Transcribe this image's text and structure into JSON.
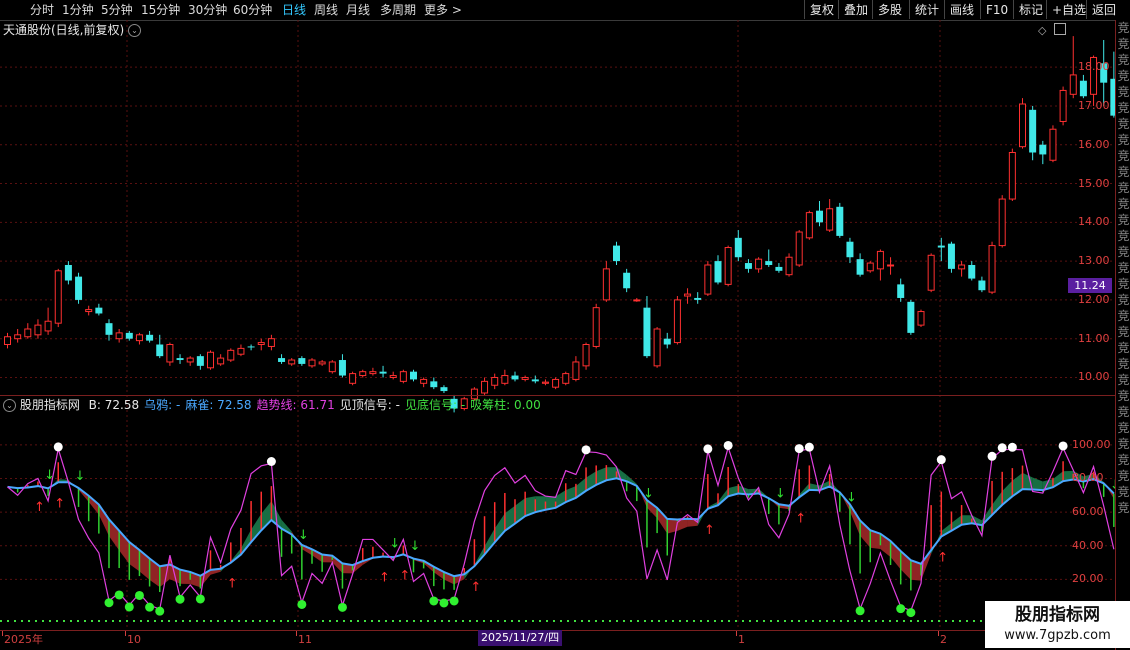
{
  "toolbar": {
    "periods": [
      "分时",
      "1分钟",
      "5分钟",
      "15分钟",
      "30分钟",
      "60分钟",
      "日线",
      "周线",
      "月线",
      "多周期",
      "更多 >"
    ],
    "active_period": "日线",
    "right_buttons": [
      "复权",
      "叠加",
      "多股",
      "统计",
      "画线",
      "F10",
      "标记",
      "+自选",
      "返回"
    ]
  },
  "main_chart": {
    "title": "天通股份(日线,前复权)",
    "last_price": "11.24",
    "y_ticks": [
      "18.00",
      "17.00",
      "16.00",
      "15.00",
      "14.00",
      "13.00",
      "12.00",
      "11.00",
      "10.00"
    ]
  },
  "indicator": {
    "name": "股朋指标网",
    "values": [
      {
        "label": "B:",
        "value": "72.58",
        "color": "#e8e8e8"
      },
      {
        "label": "乌鸦:",
        "value": "-",
        "color": "#4aa8ff"
      },
      {
        "label": "麻雀:",
        "value": "72.58",
        "color": "#4aa8ff"
      },
      {
        "label": "趋势线:",
        "value": "61.71",
        "color": "#e040e0"
      },
      {
        "label": "见顶信号:",
        "value": "-",
        "color": "#e8e8e8"
      },
      {
        "label": "见底信号:",
        "value": "-",
        "color": "#40e040"
      },
      {
        "label": "吸筹柱:",
        "value": "0.00",
        "color": "#40e040"
      }
    ],
    "y_ticks": [
      "100.00",
      "80.00",
      "60.00",
      "40.00",
      "20.00"
    ]
  },
  "x_axis": {
    "labels": [
      {
        "text": "2025年",
        "pos": 4
      },
      {
        "text": "10",
        "pos": 127
      },
      {
        "text": "11",
        "pos": 298
      },
      {
        "text": "1",
        "pos": 738
      },
      {
        "text": "2",
        "pos": 940
      }
    ],
    "cursor_date": "2025/11/27/四"
  },
  "watermark": {
    "line1": "股朋指标网",
    "line2": "www.7gpzb.com"
  },
  "right_column_chars": "竞竞竞竞竞竞竞竞竞竞竞竞竞竞竞竞竞竞竞竞竞竞竞竞竞竞竞竞竞竞竞",
  "colors": {
    "up": "#ff3030",
    "down": "#40e8e8",
    "wuya": "#4aa8ff",
    "trend": "#e040e0",
    "bottom": "#40e040"
  },
  "chart_data": {
    "type": "candlestick",
    "ylim": [
      9.6,
      18.7
    ],
    "candles": [
      [
        10.85,
        11.15,
        10.75,
        11.05
      ],
      [
        11.0,
        11.25,
        10.9,
        11.1
      ],
      [
        11.05,
        11.4,
        11.0,
        11.25
      ],
      [
        11.1,
        11.5,
        11.0,
        11.35
      ],
      [
        11.2,
        11.8,
        11.1,
        11.45
      ],
      [
        11.4,
        12.8,
        11.3,
        12.75
      ],
      [
        12.9,
        13.0,
        12.4,
        12.5
      ],
      [
        12.6,
        12.7,
        11.9,
        12.0
      ],
      [
        11.7,
        11.85,
        11.6,
        11.75
      ],
      [
        11.8,
        11.9,
        11.6,
        11.65
      ],
      [
        11.4,
        11.5,
        10.95,
        11.1
      ],
      [
        11.0,
        11.25,
        10.9,
        11.15
      ],
      [
        11.15,
        11.2,
        10.95,
        11.0
      ],
      [
        10.95,
        11.15,
        10.85,
        11.1
      ],
      [
        11.1,
        11.2,
        10.9,
        10.95
      ],
      [
        10.85,
        11.1,
        10.5,
        10.55
      ],
      [
        10.4,
        10.9,
        10.3,
        10.85
      ],
      [
        10.5,
        10.6,
        10.35,
        10.45
      ],
      [
        10.4,
        10.55,
        10.3,
        10.5
      ],
      [
        10.55,
        10.6,
        10.2,
        10.3
      ],
      [
        10.25,
        10.7,
        10.2,
        10.65
      ],
      [
        10.35,
        10.6,
        10.3,
        10.5
      ],
      [
        10.45,
        10.75,
        10.4,
        10.7
      ],
      [
        10.6,
        10.85,
        10.55,
        10.75
      ],
      [
        10.8,
        10.85,
        10.7,
        10.78
      ],
      [
        10.85,
        11.0,
        10.7,
        10.9
      ],
      [
        10.8,
        11.1,
        10.7,
        11.0
      ],
      [
        10.5,
        10.6,
        10.35,
        10.4
      ],
      [
        10.35,
        10.5,
        10.3,
        10.45
      ],
      [
        10.5,
        10.55,
        10.3,
        10.35
      ],
      [
        10.3,
        10.5,
        10.25,
        10.45
      ],
      [
        10.35,
        10.45,
        10.3,
        10.4
      ],
      [
        10.15,
        10.45,
        10.1,
        10.4
      ],
      [
        10.45,
        10.6,
        10.0,
        10.05
      ],
      [
        9.85,
        10.15,
        9.8,
        10.1
      ],
      [
        10.05,
        10.2,
        10.0,
        10.15
      ],
      [
        10.1,
        10.25,
        10.05,
        10.15
      ],
      [
        10.15,
        10.3,
        10.0,
        10.1
      ],
      [
        10.0,
        10.15,
        9.95,
        10.05
      ],
      [
        9.9,
        10.2,
        9.85,
        10.15
      ],
      [
        10.15,
        10.2,
        9.9,
        9.95
      ],
      [
        9.85,
        10.0,
        9.75,
        9.95
      ],
      [
        9.9,
        10.0,
        9.7,
        9.75
      ],
      [
        9.75,
        9.8,
        9.6,
        9.65
      ],
      [
        9.45,
        9.55,
        9.1,
        9.2
      ],
      [
        9.2,
        9.5,
        9.15,
        9.45
      ],
      [
        9.45,
        9.75,
        9.4,
        9.7
      ],
      [
        9.6,
        10.0,
        9.55,
        9.9
      ],
      [
        9.8,
        10.1,
        9.7,
        10.0
      ],
      [
        9.85,
        10.2,
        9.8,
        10.05
      ],
      [
        10.05,
        10.15,
        9.9,
        9.95
      ],
      [
        9.95,
        10.05,
        9.9,
        10.0
      ],
      [
        9.95,
        10.05,
        9.85,
        9.9
      ],
      [
        9.85,
        9.95,
        9.8,
        9.88
      ],
      [
        9.75,
        10.0,
        9.7,
        9.95
      ],
      [
        9.85,
        10.15,
        9.8,
        10.1
      ],
      [
        9.95,
        10.55,
        9.9,
        10.4
      ],
      [
        10.3,
        10.9,
        10.2,
        10.85
      ],
      [
        10.8,
        11.9,
        10.75,
        11.8
      ],
      [
        12.0,
        13.0,
        11.95,
        12.8
      ],
      [
        13.4,
        13.5,
        12.9,
        13.0
      ],
      [
        12.7,
        12.8,
        12.2,
        12.3
      ],
      [
        12.0,
        12.05,
        11.95,
        12.0
      ],
      [
        11.8,
        12.1,
        10.5,
        10.55
      ],
      [
        10.3,
        11.3,
        10.25,
        11.25
      ],
      [
        11.0,
        11.15,
        10.75,
        10.85
      ],
      [
        10.9,
        12.1,
        10.85,
        12.0
      ],
      [
        12.1,
        12.3,
        11.9,
        12.15
      ],
      [
        12.05,
        12.2,
        11.9,
        12.0
      ],
      [
        12.15,
        13.0,
        12.1,
        12.9
      ],
      [
        13.0,
        13.15,
        12.4,
        12.45
      ],
      [
        12.4,
        13.4,
        12.35,
        13.35
      ],
      [
        13.6,
        13.8,
        13.0,
        13.1
      ],
      [
        12.95,
        13.05,
        12.7,
        12.8
      ],
      [
        12.8,
        13.1,
        12.7,
        13.05
      ],
      [
        13.0,
        13.3,
        12.85,
        12.9
      ],
      [
        12.85,
        12.95,
        12.7,
        12.75
      ],
      [
        12.65,
        13.2,
        12.6,
        13.1
      ],
      [
        12.9,
        13.8,
        12.85,
        13.75
      ],
      [
        13.6,
        14.3,
        13.55,
        14.25
      ],
      [
        14.3,
        14.55,
        13.9,
        14.0
      ],
      [
        13.8,
        14.6,
        13.75,
        14.35
      ],
      [
        14.4,
        14.5,
        13.6,
        13.65
      ],
      [
        13.5,
        13.6,
        12.95,
        13.1
      ],
      [
        13.05,
        13.2,
        12.6,
        12.65
      ],
      [
        12.75,
        13.0,
        12.7,
        12.95
      ],
      [
        12.8,
        13.3,
        12.5,
        13.25
      ],
      [
        12.9,
        13.1,
        12.65,
        12.9
      ],
      [
        12.4,
        12.55,
        11.95,
        12.05
      ],
      [
        11.95,
        12.0,
        11.1,
        11.15
      ],
      [
        11.35,
        11.75,
        11.3,
        11.7
      ],
      [
        12.25,
        13.2,
        12.2,
        13.15
      ],
      [
        13.4,
        13.6,
        13.0,
        13.35
      ],
      [
        13.45,
        13.5,
        12.7,
        12.8
      ],
      [
        12.8,
        13.0,
        12.6,
        12.9
      ],
      [
        12.9,
        13.0,
        12.5,
        12.55
      ],
      [
        12.5,
        12.6,
        12.2,
        12.25
      ],
      [
        12.2,
        13.5,
        12.15,
        13.4
      ],
      [
        13.4,
        14.7,
        13.35,
        14.6
      ],
      [
        14.6,
        15.9,
        14.55,
        15.8
      ],
      [
        15.95,
        17.2,
        15.9,
        17.05
      ],
      [
        16.9,
        17.0,
        15.6,
        15.8
      ],
      [
        16.0,
        16.1,
        15.5,
        15.75
      ],
      [
        15.6,
        16.5,
        15.55,
        16.4
      ],
      [
        16.6,
        17.5,
        16.5,
        17.4
      ],
      [
        17.3,
        18.8,
        17.2,
        17.8
      ],
      [
        17.65,
        17.8,
        17.2,
        17.25
      ],
      [
        17.3,
        18.3,
        17.0,
        18.25
      ],
      [
        18.1,
        18.7,
        17.0,
        17.6
      ],
      [
        17.7,
        18.4,
        16.7,
        16.75
      ]
    ]
  }
}
